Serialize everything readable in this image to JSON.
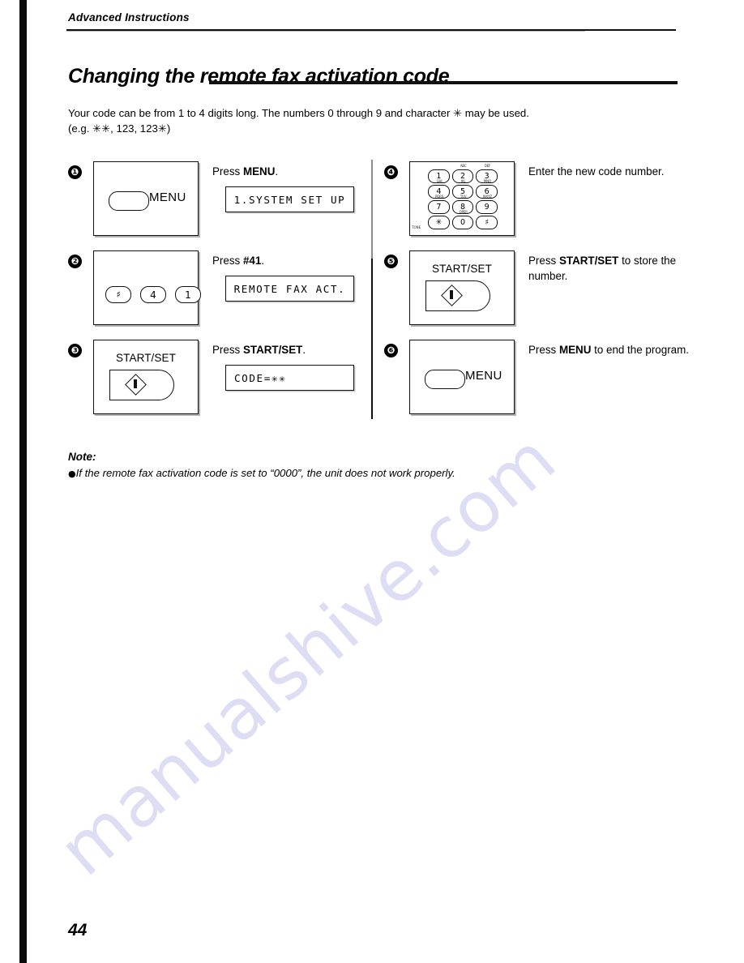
{
  "document": {
    "running_head": "Advanced Instructions",
    "title": "Changing the remote fax activation code",
    "intro_line_1": "Your code can be from 1 to 4 digits long. The numbers 0 through 9 and character ✳ may be used.",
    "intro_line_2": "(e.g. ✳✳, 123, 123✳)",
    "page_number": "44",
    "watermark": "manualshive.com"
  },
  "note": {
    "heading": "Note:",
    "bullet": "●",
    "text": "If the remote fax activation code is set to “0000”, the unit does not work properly."
  },
  "steps": {
    "left": [
      {
        "number": "❶",
        "panel_type": "menu-button",
        "button_label": "MENU",
        "instruction_prefix": "Press ",
        "instruction_bold": "MENU",
        "instruction_suffix": ".",
        "lcd": "1.SYSTEM SET UP",
        "lcd_align": "center"
      },
      {
        "number": "❷",
        "panel_type": "key-row",
        "keys": [
          "♯",
          "4",
          "1"
        ],
        "instruction_prefix": "Press ",
        "instruction_bold": "#41",
        "instruction_suffix": ".",
        "lcd": "REMOTE FAX ACT.",
        "lcd_align": "center"
      },
      {
        "number": "❸",
        "panel_type": "start-set",
        "button_label": "START/SET",
        "instruction_prefix": "Press ",
        "instruction_bold": "START/SET",
        "instruction_suffix": ".",
        "lcd": "CODE=✳✳",
        "lcd_align": "left"
      }
    ],
    "right": [
      {
        "number": "❹",
        "panel_type": "keypad",
        "instruction_prefix": "",
        "instruction_bold": "",
        "instruction_suffix": "Enter the new code number.",
        "lcd": "",
        "keypad": {
          "rows": [
            [
              {
                "key": "1",
                "sub": ""
              },
              {
                "key": "2",
                "sub": "ABC"
              },
              {
                "key": "3",
                "sub": "DEF"
              }
            ],
            [
              {
                "key": "4",
                "sub": "GHI"
              },
              {
                "key": "5",
                "sub": "JKL"
              },
              {
                "key": "6",
                "sub": "MNO"
              }
            ],
            [
              {
                "key": "7",
                "sub": "PQRS"
              },
              {
                "key": "8",
                "sub": "TUV"
              },
              {
                "key": "9",
                "sub": "WXYZ"
              }
            ],
            [
              {
                "key": "✳",
                "sub": ""
              },
              {
                "key": "0",
                "sub": "OPER"
              },
              {
                "key": "♯",
                "sub": ""
              }
            ]
          ],
          "footnote": "TONE"
        }
      },
      {
        "number": "❺",
        "panel_type": "start-set",
        "button_label": "START/SET",
        "instruction_prefix": "Press ",
        "instruction_bold": "START/SET",
        "instruction_suffix": " to store the number.",
        "lcd": ""
      },
      {
        "number": "❻",
        "panel_type": "menu-button",
        "button_label": "MENU",
        "instruction_prefix": "Press ",
        "instruction_bold": "MENU",
        "instruction_suffix": " to end the program.",
        "lcd": ""
      }
    ]
  }
}
